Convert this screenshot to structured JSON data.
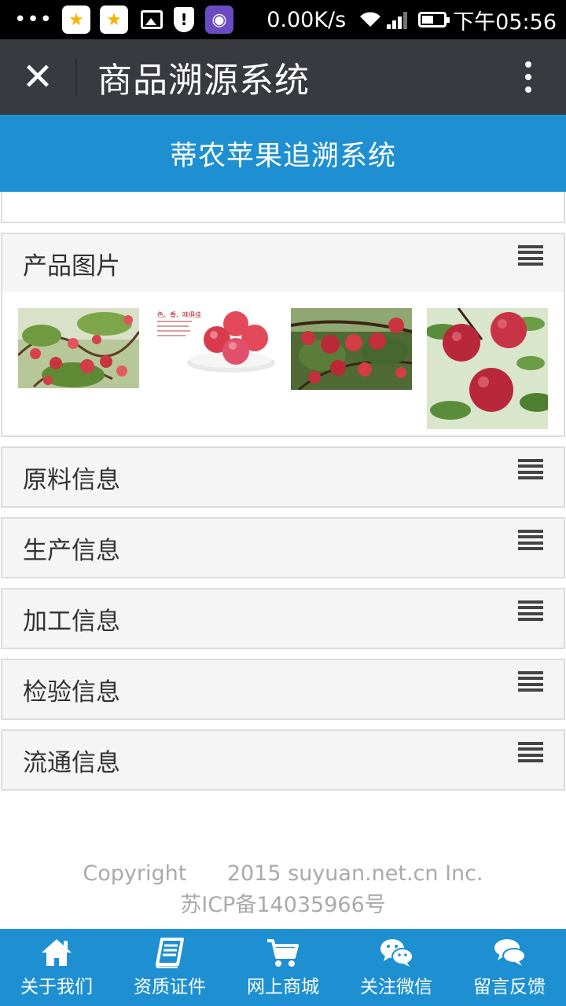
{
  "status_bar": {
    "dots": "•••",
    "net_speed": "0.00K/s",
    "time": "下午05:56",
    "icons": [
      "star-app-icon",
      "star-app-icon",
      "image-icon",
      "shield-icon",
      "purple-app-icon",
      "wifi-icon",
      "signal-icon",
      "battery-icon"
    ]
  },
  "titlebar": {
    "close_glyph": "✕",
    "title": "商品溯源系统"
  },
  "header": {
    "title": "蒂农苹果追溯系统"
  },
  "panels": [
    {
      "label": "产品图片"
    },
    {
      "label": "原料信息"
    },
    {
      "label": "生产信息"
    },
    {
      "label": "加工信息"
    },
    {
      "label": "检验信息"
    },
    {
      "label": "流通信息"
    }
  ],
  "photos": [
    {
      "name": "apple-tree-photo-1"
    },
    {
      "name": "apple-plate-photo",
      "caption": "色、香、味俱佳"
    },
    {
      "name": "apple-tree-photo-2"
    },
    {
      "name": "apple-closeup-photo"
    }
  ],
  "footer": {
    "copyright": "Copyright      2015 suyuan.net.cn Inc.",
    "icp": "苏ICP备14035966号"
  },
  "bottom_nav": [
    {
      "label": "关于我们",
      "icon": "home-icon"
    },
    {
      "label": "资质证件",
      "icon": "book-icon"
    },
    {
      "label": "网上商城",
      "icon": "cart-icon"
    },
    {
      "label": "关注微信",
      "icon": "wechat-icon"
    },
    {
      "label": "留言反馈",
      "icon": "chat-icon"
    }
  ],
  "colors": {
    "accent": "#1e90d2",
    "titlebar": "#393a3f",
    "panel_head": "#f5f5f5"
  }
}
